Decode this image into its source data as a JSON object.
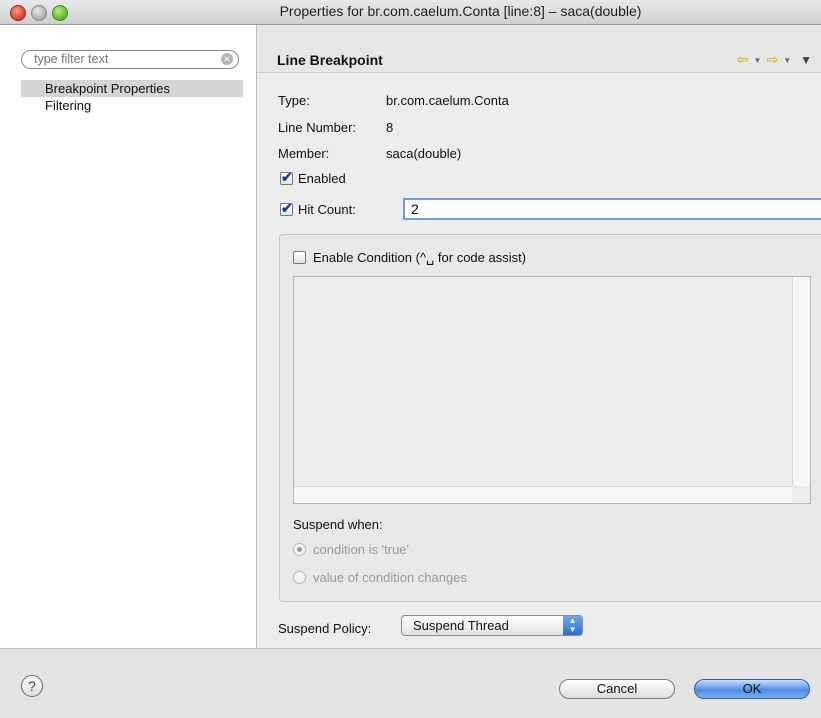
{
  "window": {
    "title": "Properties for br.com.caelum.Conta [line:8] – saca(double)"
  },
  "sidebar": {
    "filter_placeholder": "type filter text",
    "filter_value": "type filter text",
    "items": [
      {
        "label": "Breakpoint Properties",
        "selected": true
      },
      {
        "label": "Filtering",
        "selected": false
      }
    ]
  },
  "page": {
    "title": "Line Breakpoint",
    "nav": {
      "back_icon": "back-arrow-icon",
      "forward_icon": "forward-arrow-icon",
      "menu_icon": "view-menu-icon"
    }
  },
  "properties": {
    "type_label": "Type:",
    "type_value": "br.com.caelum.Conta",
    "line_label": "Line Number:",
    "line_value": "8",
    "member_label": "Member:",
    "member_value": "saca(double)"
  },
  "options": {
    "enabled_label": "Enabled",
    "enabled_checked": true,
    "hit_count_label": "Hit Count:",
    "hit_count_checked": true,
    "hit_count_value": "2"
  },
  "condition": {
    "enable_label": "Enable Condition (^␣ for code assist)",
    "enable_checked": false,
    "text": "",
    "suspend_when_label": "Suspend when:",
    "radio_true_label": "condition is 'true'",
    "radio_changes_label": "value of condition changes",
    "selected_radio": "true"
  },
  "policy": {
    "label": "Suspend Policy:",
    "value": "Suspend Thread"
  },
  "footer": {
    "help_glyph": "?",
    "cancel_label": "Cancel",
    "ok_label": "OK"
  }
}
